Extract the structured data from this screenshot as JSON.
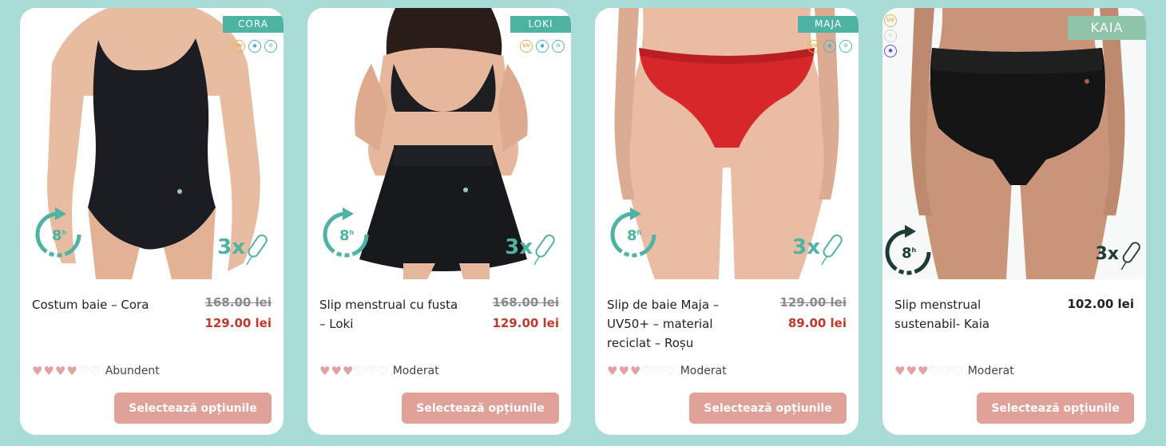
{
  "colors": {
    "background": "#a9dcd6",
    "tag": "#4fb3a3",
    "tag_kaia": "#8fc4a9",
    "old_price": "#8a8a8a",
    "sale_price": "#c0392b",
    "button": "#dfa198",
    "heart": "#e0a4a0",
    "hours_green": "#4fb3a3",
    "hours_dark": "#1e3c37"
  },
  "products": [
    {
      "tag": "CORA",
      "badges": [
        "UV",
        "drop",
        "recycle"
      ],
      "hours": "8",
      "hours_unit": "h",
      "tampons": "3x",
      "title": "Costum baie – Cora",
      "old_price": "168.00 lei",
      "price": "129.00 lei",
      "flow_level": 4,
      "flow_max": 6,
      "flow_label": "Abundent",
      "button": "Selectează opțiunile"
    },
    {
      "tag": "LOKI",
      "badges": [
        "UV",
        "drop",
        "recycle"
      ],
      "hours": "8",
      "hours_unit": "h",
      "tampons": "3x",
      "title": "Slip menstrual cu fusta – Loki",
      "old_price": "168.00 lei",
      "price": "129.00 lei",
      "flow_level": 3,
      "flow_max": 6,
      "flow_label": "Moderat",
      "button": "Selectează opțiunile"
    },
    {
      "tag": "MAJA",
      "badges": [
        "UV",
        "drop",
        "recycle"
      ],
      "hours": "8",
      "hours_unit": "h",
      "tampons": "3x",
      "title": "Slip de baie Maja – UV50+ – material reciclat – Roșu",
      "old_price": "129.00 lei",
      "price": "89.00 lei",
      "flow_level": 3,
      "flow_max": 6,
      "flow_label": "Moderat",
      "button": "Selectează opțiunile"
    },
    {
      "tag": "KAIA",
      "badges": [
        "UV",
        "recycle",
        "drop"
      ],
      "hours": "8",
      "hours_unit": "h",
      "tampons": "3x",
      "title": "Slip menstrual sustenabil- Kaia",
      "price": "102.00 lei",
      "flow_level": 3,
      "flow_max": 6,
      "flow_label": "Moderat",
      "button": "Selectează opțiunile"
    }
  ]
}
